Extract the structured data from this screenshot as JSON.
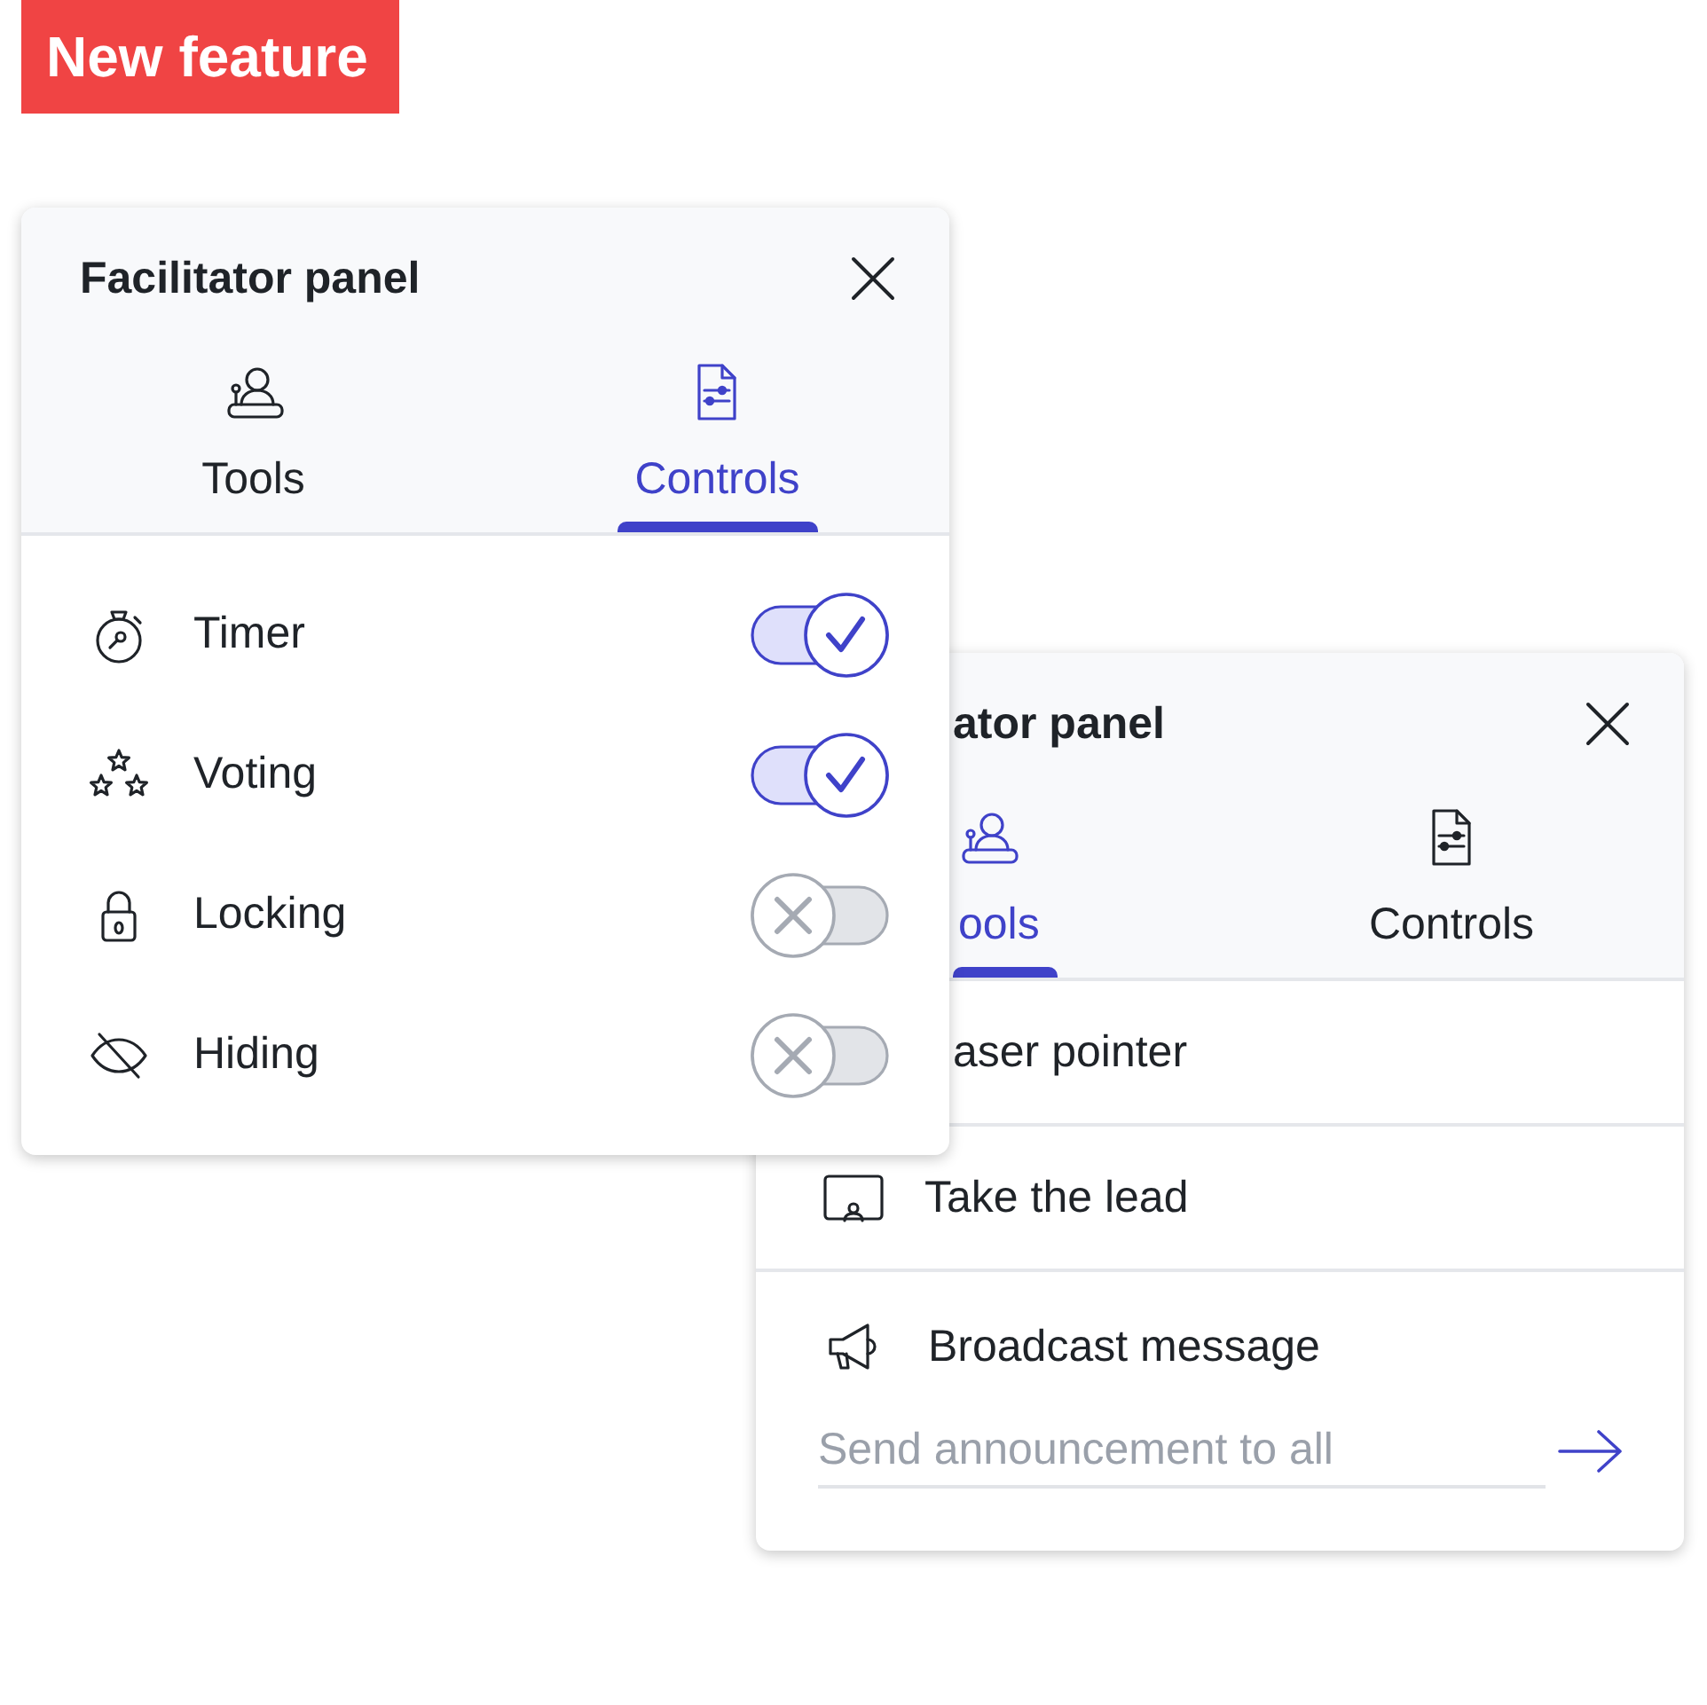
{
  "badge": {
    "label": "New feature"
  },
  "panels": [
    {
      "title": "Facilitator panel",
      "tabs": [
        {
          "label": "Tools",
          "selected": false
        },
        {
          "label": "Controls",
          "selected": true
        }
      ],
      "controls": [
        {
          "label": "Timer",
          "on": true
        },
        {
          "label": "Voting",
          "on": true
        },
        {
          "label": "Locking",
          "on": false
        },
        {
          "label": "Hiding",
          "on": false
        }
      ]
    },
    {
      "title": "ator panel",
      "tabs": [
        {
          "label": "ools",
          "selected": true
        },
        {
          "label": "Controls",
          "selected": false
        }
      ],
      "tools": [
        {
          "label": "aser pointer"
        },
        {
          "label": "Take the lead"
        },
        {
          "label": "Broadcast message",
          "placeholder": "Send announcement to all"
        }
      ]
    }
  ]
}
